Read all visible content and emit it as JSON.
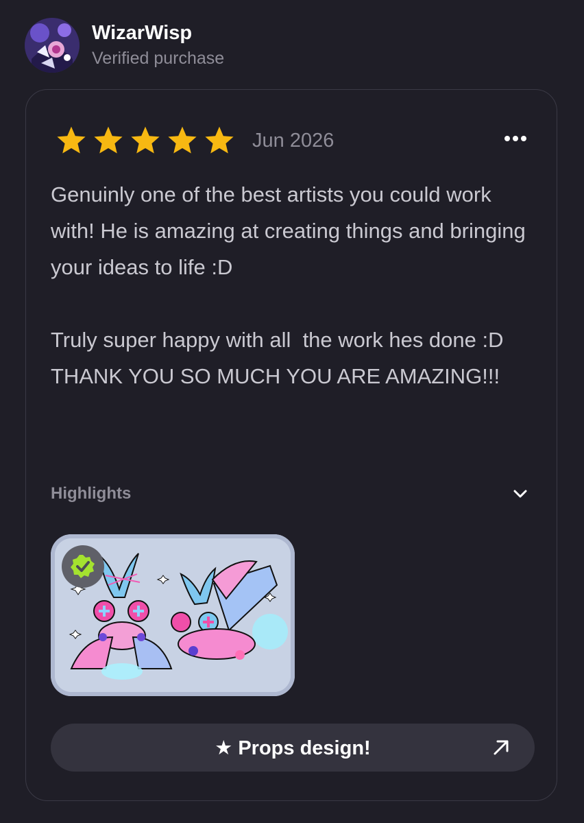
{
  "reviewer": {
    "name": "WizarWisp",
    "status": "Verified purchase",
    "avatar_icon": "avatar-image"
  },
  "review": {
    "rating": 5,
    "rating_max": 5,
    "date": "Jun 2026",
    "star_color": "#f7b812",
    "paragraphs": [
      "Genuinly one of the best artists you could work with! He is amazing at creating things and bringing your ideas to life :D",
      "Truly super happy with all  the work hes done :D\nTHANK YOU SO MUCH YOU ARE AMAZING!!!"
    ]
  },
  "highlights": {
    "label": "Highlights",
    "badge_icon": "check-shield-icon",
    "badge_color": "#a4e22f"
  },
  "product_button": {
    "label": "★ Props design!",
    "icon": "arrow-up-right-icon"
  }
}
